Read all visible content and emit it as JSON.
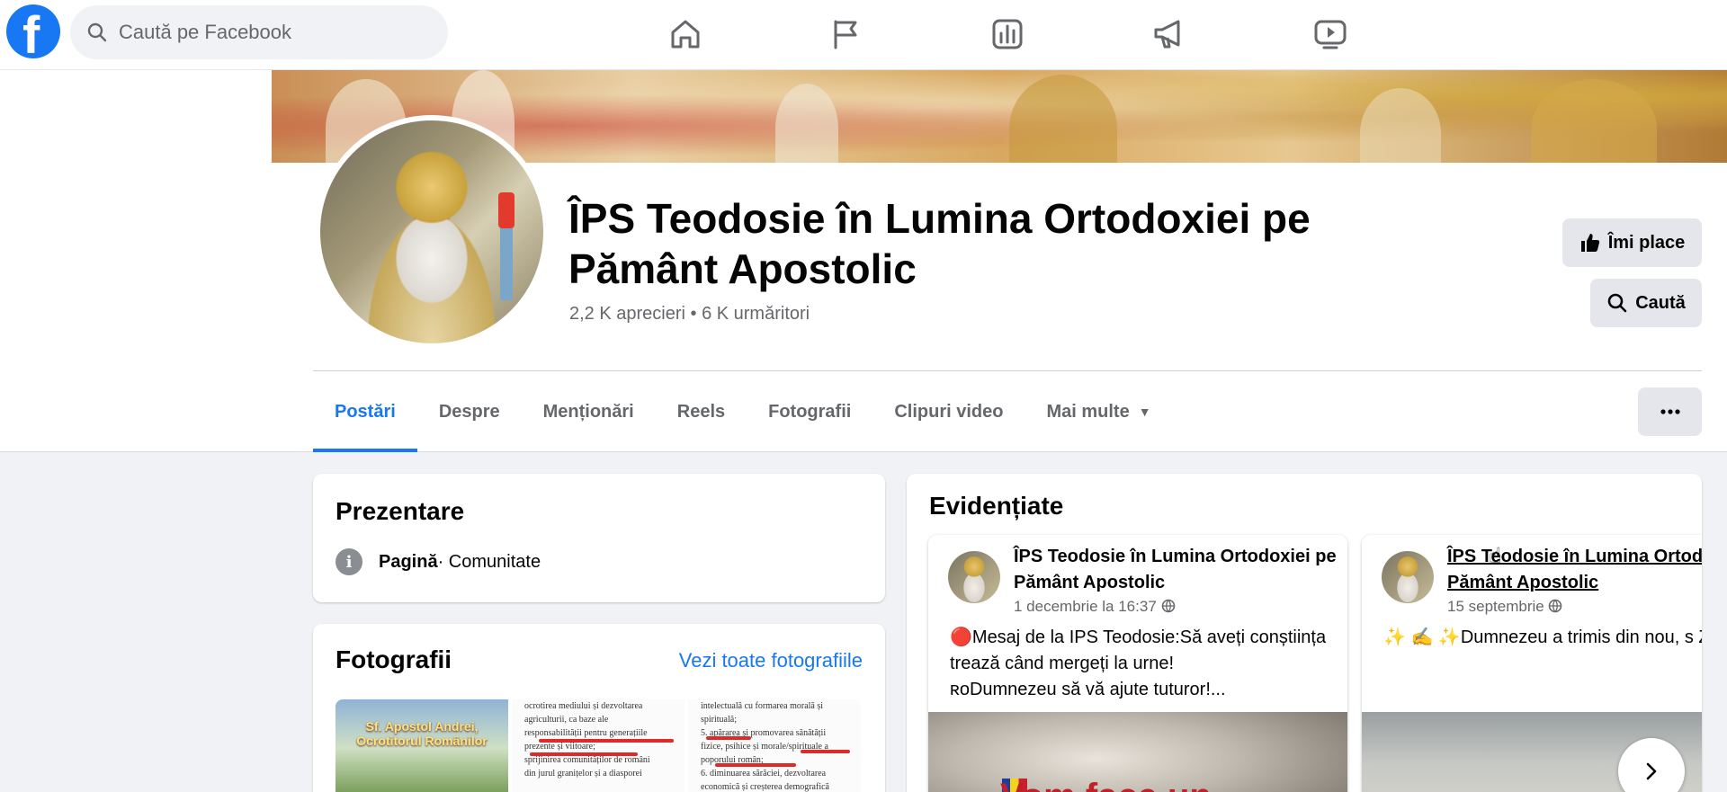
{
  "topbar": {
    "search_placeholder": "Caută pe Facebook",
    "nav": [
      "home-icon",
      "flag-icon",
      "insights-icon",
      "megaphone-icon",
      "video-icon"
    ]
  },
  "page": {
    "title": "ÎPS Teodosie în Lumina Ortodoxiei pe Pământ Apostolic",
    "stats": "2,2 K aprecieri • 6 K urmăritori",
    "like_label": "Îmi place",
    "search_label": "Caută"
  },
  "tabs": [
    {
      "label": "Postări",
      "active": true
    },
    {
      "label": "Despre"
    },
    {
      "label": "Menționări"
    },
    {
      "label": "Reels"
    },
    {
      "label": "Fotografii"
    },
    {
      "label": "Clipuri video"
    },
    {
      "label": "Mai multe"
    }
  ],
  "intro": {
    "title": "Prezentare",
    "type_bold": "Pagină",
    "type_rest": " · Comunitate"
  },
  "photos": {
    "title": "Fotografii",
    "see_all": "Vezi toate fotografiile",
    "thumb1_caption": "Sf. Apostol Andrei, Ocrotitorul Românilor",
    "thumb2_text": [
      "ocrotirea mediului și dezvoltarea",
      "agriculturii, ca baze ale",
      "responsabilității pentru generațiile",
      "prezente și viitoare;",
      "sprijinirea comunităților de români",
      "din jurul granițelor și a diasporei"
    ],
    "thumb3_text": [
      "intelectuală cu formarea morală și",
      "spirituală;",
      "5. apărarea și promovarea sănătății",
      "fizice, psihice și morale/spirituale a",
      "poporului român;",
      "6. diminuarea sărăciei, dezvoltarea",
      "economică și creșterea demografică"
    ]
  },
  "highlights": {
    "title": "Evidențiate",
    "posts": [
      {
        "author": "ÎPS Teodosie în Lumina Ortodoxiei pe Pământ Apostolic",
        "date": "1 decembrie la 16:37",
        "body": "🔴Mesaj de la IPS Teodosie:Să aveți conștiința trează când mergeți la urne!\nʀᴏDumnezeu să vă ajute tuturor!...",
        "image_text": "Vom face un"
      },
      {
        "author": "ÎPS Teodosie în Lumina Ortodoxiei pe Pământ Apostolic",
        "date": "15 septembrie",
        "body": "✨ ✍️ ✨Dumnezeu a trimis din nou, s\nZIUA ÎNĂLȚĂRII SFINTEI CRUCI,\nBINECUVÂNTAREA DIN CER, PESTE SFÂ"
      }
    ]
  },
  "colors": {
    "brand": "#1877f2",
    "background": "#f0f2f5",
    "secondary_text": "#65676b"
  }
}
